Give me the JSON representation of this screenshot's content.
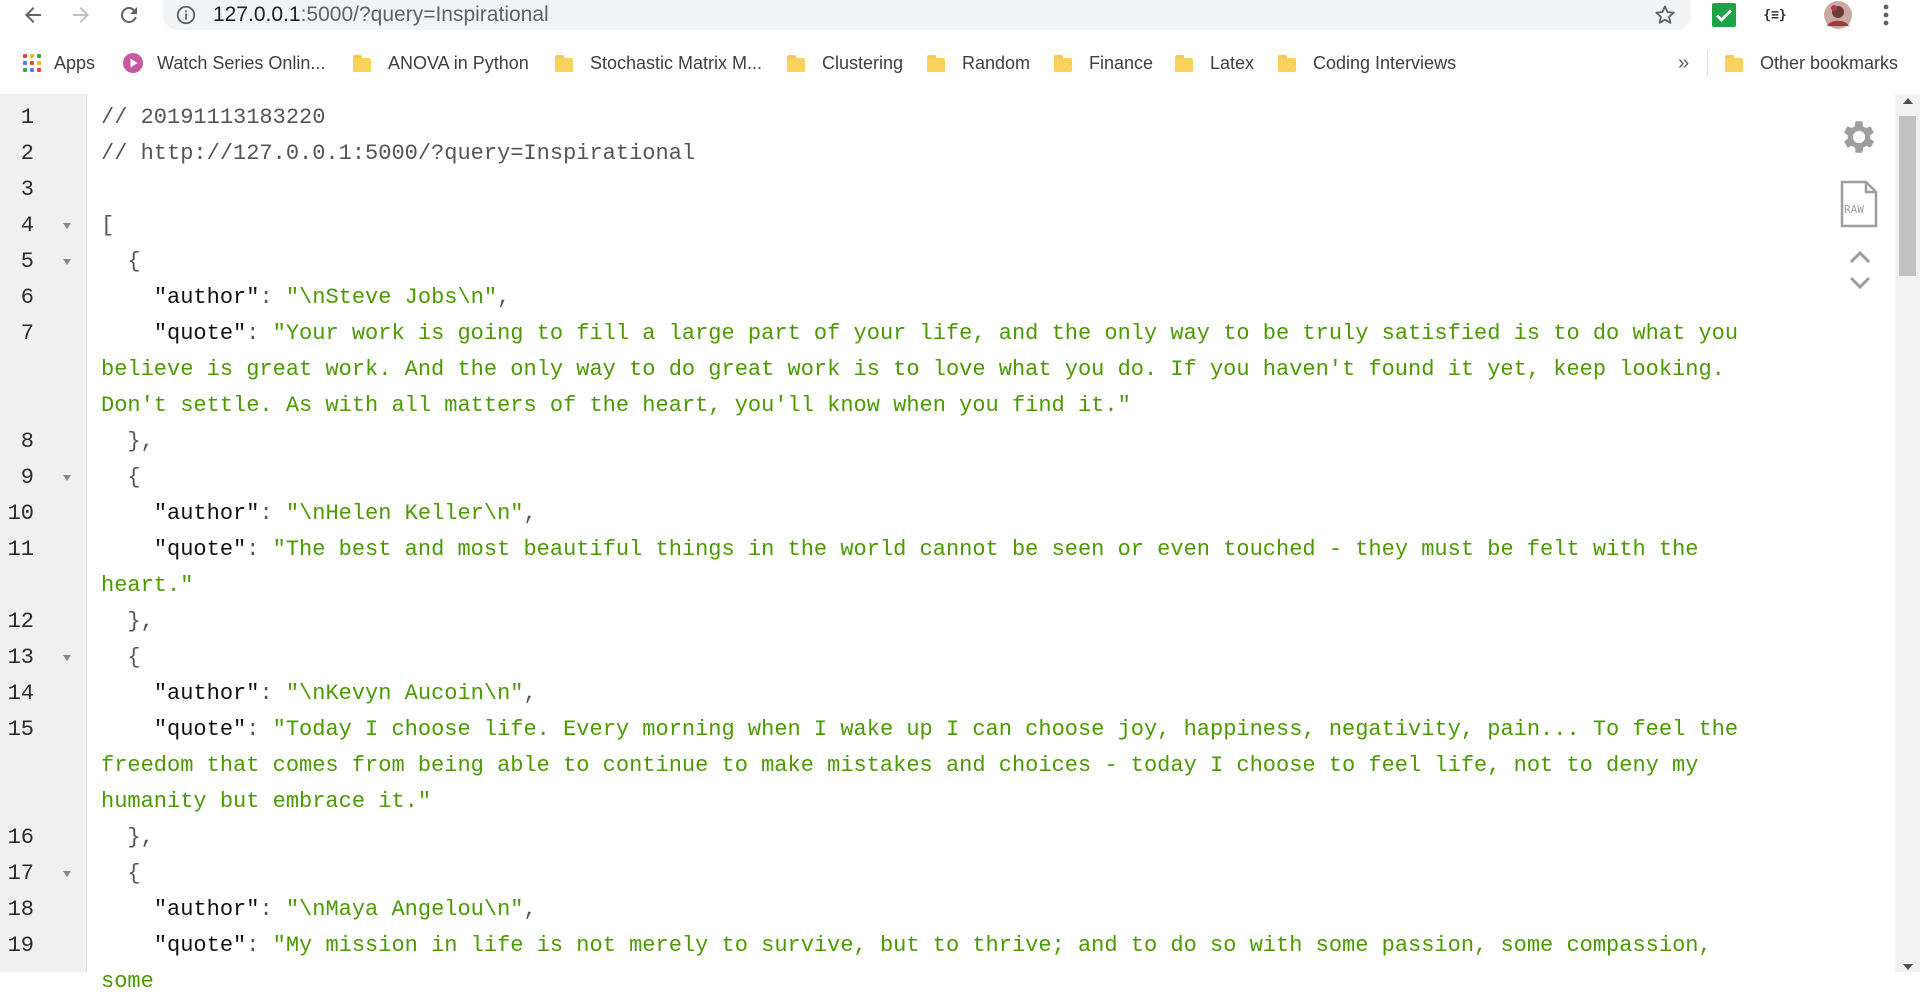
{
  "browser": {
    "url_host": "127.0.0.1",
    "url_path": ":5000/?query=Inspirational",
    "extension_label": "{≡}",
    "bookmarks": [
      {
        "label": "Apps",
        "icon": "apps-grid-icon"
      },
      {
        "label": "Watch Series Onlin...",
        "icon": "play-icon"
      },
      {
        "label": "ANOVA in Python",
        "icon": "folder-icon"
      },
      {
        "label": "Stochastic Matrix M...",
        "icon": "folder-icon"
      },
      {
        "label": "Clustering",
        "icon": "folder-icon"
      },
      {
        "label": "Random",
        "icon": "folder-icon"
      },
      {
        "label": "Finance",
        "icon": "folder-icon"
      },
      {
        "label": "Latex",
        "icon": "folder-icon"
      },
      {
        "label": "Coding Interviews",
        "icon": "folder-icon"
      }
    ],
    "overflow_label": "»",
    "other_bookmarks": "Other bookmarks"
  },
  "viewer": {
    "raw_label": "RAW",
    "lines": [
      {
        "n": "1",
        "parts": [
          {
            "t": "// 20191113183220",
            "c": "comment"
          }
        ]
      },
      {
        "n": "2",
        "parts": [
          {
            "t": "// http://127.0.0.1:5000/?query=Inspirational",
            "c": "comment"
          }
        ]
      },
      {
        "n": "3",
        "parts": []
      },
      {
        "n": "4",
        "fold": true,
        "parts": [
          {
            "t": "[",
            "c": "punc"
          }
        ]
      },
      {
        "n": "5",
        "fold": true,
        "parts": [
          {
            "t": "  {",
            "c": "punc"
          }
        ]
      },
      {
        "n": "6",
        "parts": [
          {
            "t": "    ",
            "c": "punc"
          },
          {
            "t": "\"author\"",
            "c": "key"
          },
          {
            "t": ": ",
            "c": "punc"
          },
          {
            "t": "\"\\nSteve Jobs\\n\"",
            "c": "str"
          },
          {
            "t": ",",
            "c": "punc"
          }
        ]
      },
      {
        "n": "7",
        "parts": [
          {
            "t": "    ",
            "c": "punc"
          },
          {
            "t": "\"quote\"",
            "c": "key"
          },
          {
            "t": ": ",
            "c": "punc"
          },
          {
            "t": "\"Your work is going to fill a large part of your life, and the only way to be truly satisfied is to do what you believe is great work. And the only way to do great work is to love what you do. If you haven't found it yet, keep looking. Don't settle. As with all matters of the heart, you'll know when you find it.\"",
            "c": "str"
          }
        ]
      },
      {
        "n": "8",
        "parts": [
          {
            "t": "  },",
            "c": "punc"
          }
        ]
      },
      {
        "n": "9",
        "fold": true,
        "parts": [
          {
            "t": "  {",
            "c": "punc"
          }
        ]
      },
      {
        "n": "10",
        "parts": [
          {
            "t": "    ",
            "c": "punc"
          },
          {
            "t": "\"author\"",
            "c": "key"
          },
          {
            "t": ": ",
            "c": "punc"
          },
          {
            "t": "\"\\nHelen Keller\\n\"",
            "c": "str"
          },
          {
            "t": ",",
            "c": "punc"
          }
        ]
      },
      {
        "n": "11",
        "parts": [
          {
            "t": "    ",
            "c": "punc"
          },
          {
            "t": "\"quote\"",
            "c": "key"
          },
          {
            "t": ": ",
            "c": "punc"
          },
          {
            "t": "\"The best and most beautiful things in the world cannot be seen or even touched - they must be felt with the heart.\"",
            "c": "str"
          }
        ]
      },
      {
        "n": "12",
        "parts": [
          {
            "t": "  },",
            "c": "punc"
          }
        ]
      },
      {
        "n": "13",
        "fold": true,
        "parts": [
          {
            "t": "  {",
            "c": "punc"
          }
        ]
      },
      {
        "n": "14",
        "parts": [
          {
            "t": "    ",
            "c": "punc"
          },
          {
            "t": "\"author\"",
            "c": "key"
          },
          {
            "t": ": ",
            "c": "punc"
          },
          {
            "t": "\"\\nKevyn Aucoin\\n\"",
            "c": "str"
          },
          {
            "t": ",",
            "c": "punc"
          }
        ]
      },
      {
        "n": "15",
        "parts": [
          {
            "t": "    ",
            "c": "punc"
          },
          {
            "t": "\"quote\"",
            "c": "key"
          },
          {
            "t": ": ",
            "c": "punc"
          },
          {
            "t": "\"Today I choose life. Every morning when I wake up I can choose joy, happiness, negativity, pain... To feel the freedom that comes from being able to continue to make mistakes and choices - today I choose to feel life, not to deny my humanity but embrace it.\"",
            "c": "str"
          }
        ]
      },
      {
        "n": "16",
        "parts": [
          {
            "t": "  },",
            "c": "punc"
          }
        ]
      },
      {
        "n": "17",
        "fold": true,
        "parts": [
          {
            "t": "  {",
            "c": "punc"
          }
        ]
      },
      {
        "n": "18",
        "parts": [
          {
            "t": "    ",
            "c": "punc"
          },
          {
            "t": "\"author\"",
            "c": "key"
          },
          {
            "t": ": ",
            "c": "punc"
          },
          {
            "t": "\"\\nMaya Angelou\\n\"",
            "c": "str"
          },
          {
            "t": ",",
            "c": "punc"
          }
        ]
      },
      {
        "n": "19",
        "parts": [
          {
            "t": "    ",
            "c": "punc"
          },
          {
            "t": "\"quote\"",
            "c": "key"
          },
          {
            "t": ": ",
            "c": "punc"
          },
          {
            "t": "\"My mission in life is not merely to survive, but to thrive; and to do so with some passion, some compassion, some",
            "c": "str"
          }
        ]
      }
    ]
  }
}
